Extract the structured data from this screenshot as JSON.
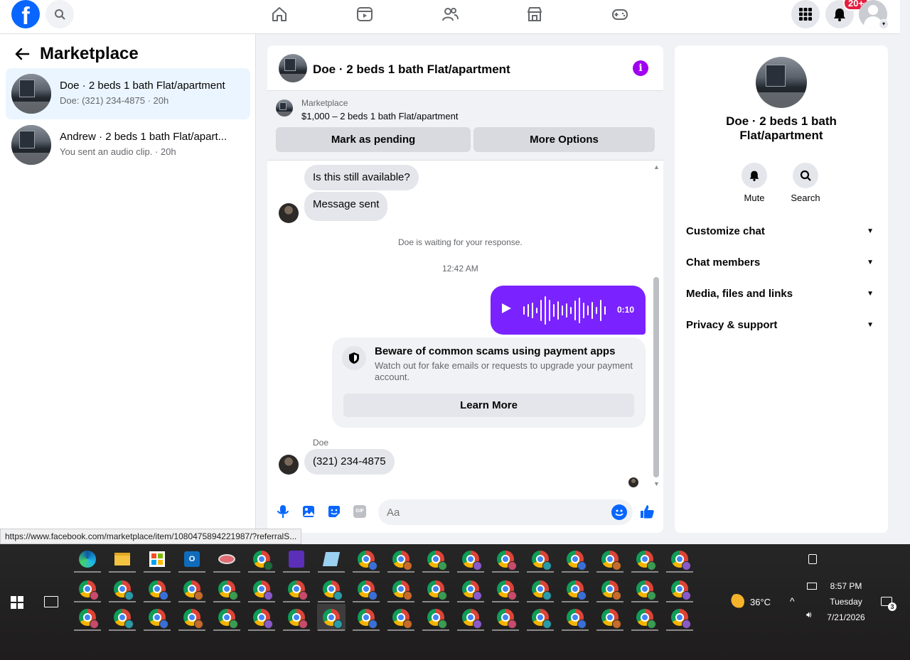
{
  "topnav": {
    "logo": "f",
    "notif_badge": "20+",
    "icons": [
      "home-icon",
      "video-icon",
      "friends-icon",
      "marketplace-icon",
      "gaming-icon"
    ]
  },
  "left": {
    "title": "Marketplace",
    "conversations": [
      {
        "name": "Doe · 2 beds 1 bath Flat/apartment",
        "sub": "Doe: (321) 234-4875 · 20h",
        "active": true
      },
      {
        "name": "Andrew · 2 beds 1 bath Flat/apart...",
        "sub": "You sent an audio clip. · 20h",
        "active": false
      }
    ]
  },
  "chat": {
    "title": "Doe · 2 beds 1 bath Flat/apartment",
    "marketplace_label": "Marketplace",
    "item": "$1,000 – 2 beds 1 bath Flat/apartment",
    "mark_pending": "Mark as pending",
    "more_options": "More Options",
    "messages": {
      "m1": "Is this still available?",
      "m2": "Message sent",
      "waiting": "Doe is waiting for your response.",
      "time": "12:42 AM",
      "audio_duration": "0:10",
      "sender": "Doe",
      "phone": "(321) 234-4875"
    },
    "scam": {
      "title": "Beware of common scams using payment apps",
      "body": "Watch out for fake emails or requests to upgrade your payment account.",
      "button": "Learn More"
    },
    "input_placeholder": "Aa",
    "gif_label": "GIF"
  },
  "right": {
    "title": "Doe · 2 beds 1 bath Flat/apartment",
    "mute": "Mute",
    "search": "Search",
    "sections": [
      "Customize chat",
      "Chat members",
      "Media, files and links",
      "Privacy & support"
    ]
  },
  "status_url": "https://www.facebook.com/marketplace/item/1080475894221987/?referralS...",
  "taskbar": {
    "weather": "36°C",
    "time": "8:57 PM",
    "day": "Tuesday",
    "date": "7/21/2026",
    "notif_count": "3",
    "accent": "#0866ff"
  }
}
